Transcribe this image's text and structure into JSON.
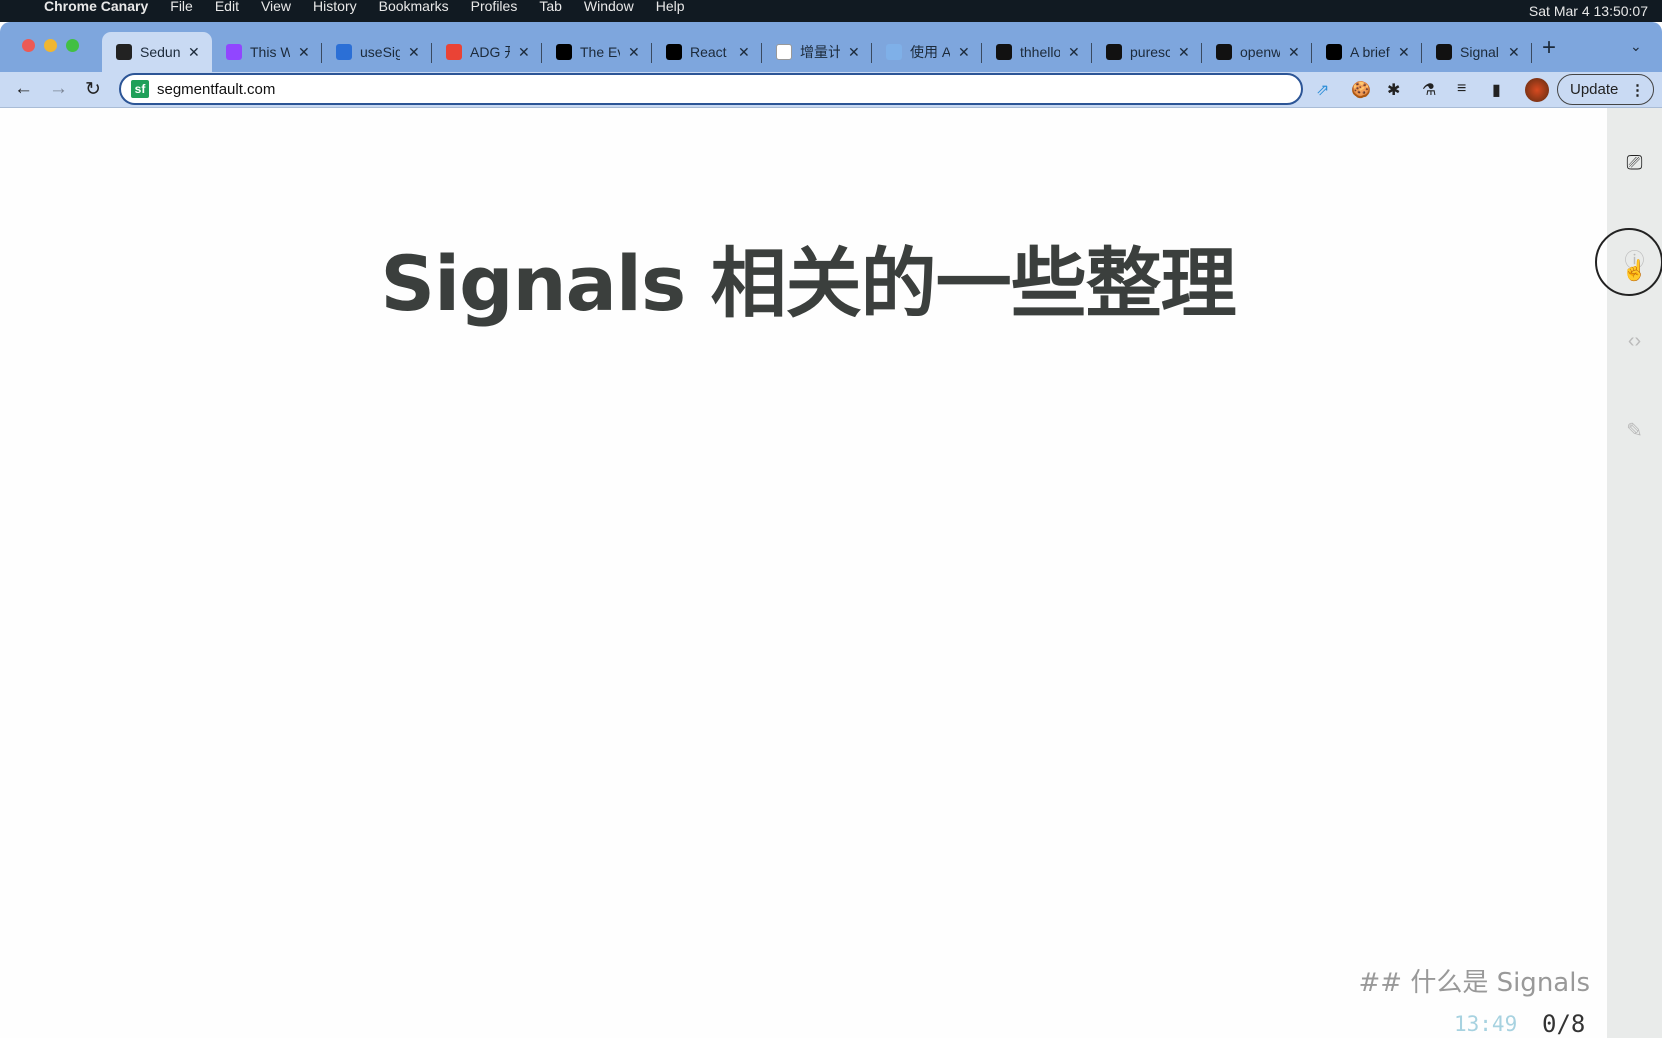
{
  "menubar": {
    "app": "Chrome Canary",
    "items": [
      "File",
      "Edit",
      "View",
      "History",
      "Bookmarks",
      "Profiles",
      "Tab",
      "Window",
      "Help"
    ],
    "clock": "Sat Mar 4  13:50:07"
  },
  "tabs": [
    {
      "title": "Sedun",
      "icon": "sparkle-icon",
      "color": "#222222",
      "active": true
    },
    {
      "title": "This W",
      "icon": "twitch-icon",
      "color": "#9146ff"
    },
    {
      "title": "useSig",
      "icon": "bing-icon",
      "color": "#2b6fd6"
    },
    {
      "title": "ADG 开",
      "icon": "google-icon",
      "color": "#ea4335"
    },
    {
      "title": "The Ev",
      "icon": "dev-icon",
      "color": "#000000"
    },
    {
      "title": "React",
      "icon": "dev-icon",
      "color": "#000000"
    },
    {
      "title": "增量计",
      "icon": "wikipedia-icon",
      "color": "#ffffff"
    },
    {
      "title": "使用 A",
      "icon": "globe-icon",
      "color": "#7fb0e8"
    },
    {
      "title": "thhello",
      "icon": "github-icon",
      "color": "#111111"
    },
    {
      "title": "puresc",
      "icon": "github-icon",
      "color": "#111111"
    },
    {
      "title": "openw",
      "icon": "github-icon",
      "color": "#111111"
    },
    {
      "title": "A brief",
      "icon": "medium-icon",
      "color": "#000000"
    },
    {
      "title": "Signal",
      "icon": "github-icon",
      "color": "#111111"
    }
  ],
  "toolbar": {
    "url": "segmentfault.com",
    "site_icon": "sf",
    "update_label": "Update"
  },
  "slide": {
    "title": "Signals 相关的一些整理",
    "next_preview": "## 什么是 Signals",
    "timer": "13:49",
    "progress": "0/8"
  }
}
